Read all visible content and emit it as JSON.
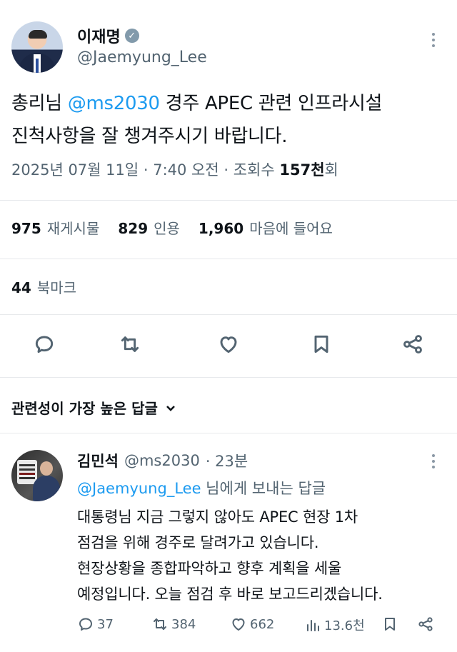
{
  "tweet": {
    "author_name": "이재명",
    "author_handle": "@Jaemyung_Lee",
    "text_prefix": "총리님 ",
    "mention": "@ms2030",
    "text_line1_rest": " 경주 APEC 관련 인프라시설",
    "text_line2": "진척사항을 잘 챙겨주시기 바랍니다.",
    "meta_prefix": "2025년 07월 11일 · 7:40 오전 · 조회수 ",
    "views_count": "157천",
    "views_suffix": "회"
  },
  "stats": {
    "retweets_count": "975",
    "retweets_label": "재게시물",
    "quotes_count": "829",
    "quotes_label": "인용",
    "likes_count": "1,960",
    "likes_label": "마음에 들어요",
    "bookmarks_count": "44",
    "bookmarks_label": "북마크"
  },
  "actions": {
    "icons": [
      "reply-icon",
      "retweet-icon",
      "heart-icon",
      "bookmark-icon",
      "share-icon"
    ]
  },
  "replies_sort": {
    "label": "관련성이 가장 높은 답글"
  },
  "reply": {
    "author_name": "김민석",
    "author_handle": "@ms2030",
    "time": "· 23분",
    "replying_to_handle": "@Jaemyung_Lee",
    "replying_to_suffix": " 님에게 보내는 답글",
    "lines": [
      "대통령님 지금 그렇지 않아도 APEC 현장 1차",
      "점검을 위해 경주로 달려가고 있습니다.",
      "현장상황을 종합파악하고 향후 계획을 세울",
      "예정입니다. 오늘 점검 후 바로 보고드리겠습니다."
    ],
    "reply_count": "37",
    "retweet_count": "384",
    "like_count": "662",
    "view_count": "13.6천"
  },
  "colors": {
    "link": "#1d9bf0",
    "text": "#0f1419",
    "muted": "#536471",
    "divider": "#e7e9ec"
  }
}
